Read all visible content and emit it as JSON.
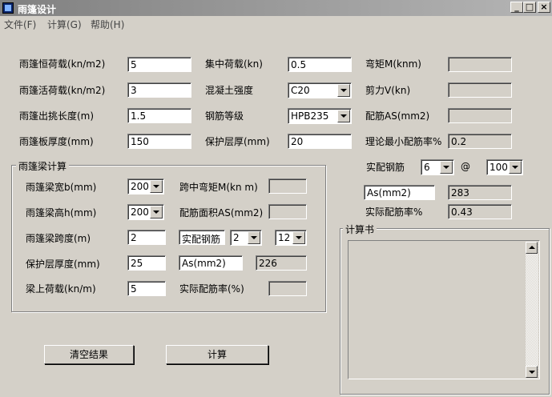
{
  "window": {
    "title": "雨篷设计",
    "minimize": "_",
    "maximize": "□",
    "close": "×"
  },
  "menu": [
    "文件(F)",
    "计算(G)",
    "帮助(H)"
  ],
  "slab": {
    "dead_load_label": "雨篷恒荷载(kn/m2)",
    "dead_load": "5",
    "live_load_label": "雨篷活荷载(kn/m2)",
    "live_load": "3",
    "overhang_label": "雨篷出挑长度(m)",
    "overhang": "1.5",
    "thickness_label": "雨篷板厚度(mm)",
    "thickness": "150",
    "point_load_label": "集中荷载(kn)",
    "point_load": "0.5",
    "concrete_label": "混凝土强度",
    "concrete": "C20",
    "steel_label": "钢筋等级",
    "steel": "HPB235",
    "cover_label": "保护层厚(mm)",
    "cover": "20",
    "moment_label": "弯矩M(knm)",
    "moment": "",
    "shear_label": "剪力V(kn)",
    "shear": "",
    "as_label": "配筋AS(mm2)",
    "as": "",
    "min_ratio_label": "理论最小配筋率%",
    "min_ratio": "0.2",
    "actual_rebar_label": "实配钢筋",
    "rebar_dia": "6",
    "at_sign": "@",
    "rebar_spacing": "100",
    "as_actual_label": "As(mm2)",
    "as_actual": "283",
    "actual_ratio_label": "实际配筋率%",
    "actual_ratio": "0.43"
  },
  "beam": {
    "title": "雨篷梁计算",
    "width_label": "雨篷梁宽b(mm)",
    "width": "200",
    "height_label": "雨篷梁高h(mm)",
    "height": "200",
    "span_label": "雨篷梁跨度(m)",
    "span": "2",
    "cover_label": "保护层厚度(mm)",
    "cover": "25",
    "load_label": "梁上荷载(kn/m)",
    "load": "5",
    "mid_moment_label": "跨中弯矩M(kn m)",
    "mid_moment": "",
    "area_label": "配筋面积AS(mm2)",
    "area": "",
    "rebar_label": "实配钢筋",
    "rebar_count": "2",
    "rebar_dia": "12",
    "as_label": "As(mm2)",
    "as_value": "226",
    "ratio_label": "实际配筋率(%)",
    "ratio": ""
  },
  "calc_book": {
    "title": "计算书"
  },
  "buttons": {
    "clear": "清空结果",
    "calculate": "计算"
  }
}
